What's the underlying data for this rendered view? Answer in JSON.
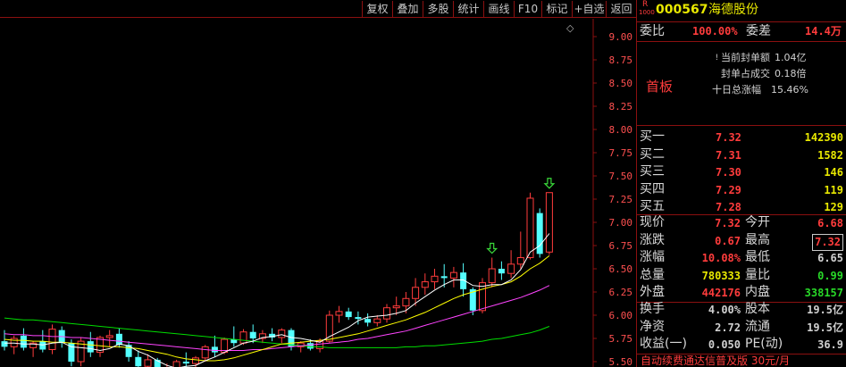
{
  "toolbar": {
    "buttons": [
      "复权",
      "叠加",
      "多股",
      "统计",
      "画线",
      "F10",
      "标记",
      "+自选",
      "返回"
    ]
  },
  "chart": {
    "y_ticks": [
      "9.00",
      "8.75",
      "8.50",
      "8.25",
      "8.00",
      "7.75",
      "7.50",
      "7.25",
      "7.00",
      "6.75",
      "6.50",
      "6.25",
      "6.00",
      "5.75",
      "5.50"
    ],
    "diamond_icon": "◇",
    "colors": {
      "up": "#ff3c3c",
      "down": "#54ffff",
      "ma5": "#ffffff",
      "ma10": "#ffff00",
      "ma20": "#ff44ff",
      "ma60": "#00dd00",
      "axis": "#8b1010",
      "tick_text": "#ff5050"
    }
  },
  "chart_data": {
    "type": "candlestick",
    "ylim": [
      5.5,
      9.0
    ],
    "candles": [
      {
        "o": 5.72,
        "h": 5.84,
        "l": 5.62,
        "c": 5.66
      },
      {
        "o": 5.66,
        "h": 5.78,
        "l": 5.58,
        "c": 5.75
      },
      {
        "o": 5.78,
        "h": 5.86,
        "l": 5.62,
        "c": 5.65
      },
      {
        "o": 5.65,
        "h": 5.72,
        "l": 5.55,
        "c": 5.7
      },
      {
        "o": 5.72,
        "h": 5.84,
        "l": 5.6,
        "c": 5.63
      },
      {
        "o": 5.63,
        "h": 5.9,
        "l": 5.58,
        "c": 5.85
      },
      {
        "o": 5.84,
        "h": 5.88,
        "l": 5.65,
        "c": 5.7
      },
      {
        "o": 5.7,
        "h": 5.74,
        "l": 5.45,
        "c": 5.5
      },
      {
        "o": 5.5,
        "h": 5.76,
        "l": 5.45,
        "c": 5.72
      },
      {
        "o": 5.72,
        "h": 5.82,
        "l": 5.55,
        "c": 5.6
      },
      {
        "o": 5.6,
        "h": 5.78,
        "l": 5.55,
        "c": 5.76
      },
      {
        "o": 5.76,
        "h": 5.84,
        "l": 5.66,
        "c": 5.78
      },
      {
        "o": 5.8,
        "h": 5.86,
        "l": 5.65,
        "c": 5.68
      },
      {
        "o": 5.68,
        "h": 5.72,
        "l": 5.5,
        "c": 5.55
      },
      {
        "o": 5.55,
        "h": 5.62,
        "l": 5.4,
        "c": 5.45
      },
      {
        "o": 5.45,
        "h": 5.58,
        "l": 5.35,
        "c": 5.52
      },
      {
        "o": 5.52,
        "h": 5.54,
        "l": 5.3,
        "c": 5.35
      },
      {
        "o": 5.35,
        "h": 5.48,
        "l": 5.28,
        "c": 5.4
      },
      {
        "o": 5.4,
        "h": 5.52,
        "l": 5.3,
        "c": 5.5
      },
      {
        "o": 5.5,
        "h": 5.6,
        "l": 5.42,
        "c": 5.48
      },
      {
        "o": 5.48,
        "h": 5.56,
        "l": 5.42,
        "c": 5.54
      },
      {
        "o": 5.54,
        "h": 5.68,
        "l": 5.5,
        "c": 5.66
      },
      {
        "o": 5.66,
        "h": 5.78,
        "l": 5.55,
        "c": 5.6
      },
      {
        "o": 5.6,
        "h": 5.76,
        "l": 5.58,
        "c": 5.74
      },
      {
        "o": 5.74,
        "h": 5.88,
        "l": 5.66,
        "c": 5.7
      },
      {
        "o": 5.7,
        "h": 5.85,
        "l": 5.68,
        "c": 5.82
      },
      {
        "o": 5.82,
        "h": 5.9,
        "l": 5.7,
        "c": 5.75
      },
      {
        "o": 5.75,
        "h": 5.84,
        "l": 5.7,
        "c": 5.8
      },
      {
        "o": 5.8,
        "h": 5.86,
        "l": 5.72,
        "c": 5.76
      },
      {
        "o": 5.76,
        "h": 5.86,
        "l": 5.7,
        "c": 5.84
      },
      {
        "o": 5.84,
        "h": 5.86,
        "l": 5.62,
        "c": 5.66
      },
      {
        "o": 5.66,
        "h": 5.72,
        "l": 5.6,
        "c": 5.7
      },
      {
        "o": 5.7,
        "h": 5.74,
        "l": 5.62,
        "c": 5.64
      },
      {
        "o": 5.64,
        "h": 5.75,
        "l": 5.6,
        "c": 5.72
      },
      {
        "o": 5.72,
        "h": 6.05,
        "l": 5.7,
        "c": 6.0
      },
      {
        "o": 6.0,
        "h": 6.1,
        "l": 5.92,
        "c": 6.04
      },
      {
        "o": 6.04,
        "h": 6.08,
        "l": 5.95,
        "c": 5.98
      },
      {
        "o": 5.98,
        "h": 6.04,
        "l": 5.9,
        "c": 5.96
      },
      {
        "o": 5.96,
        "h": 6.02,
        "l": 5.88,
        "c": 5.92
      },
      {
        "o": 5.92,
        "h": 6.0,
        "l": 5.88,
        "c": 5.96
      },
      {
        "o": 5.96,
        "h": 6.12,
        "l": 5.92,
        "c": 6.08
      },
      {
        "o": 6.08,
        "h": 6.2,
        "l": 6.0,
        "c": 6.1
      },
      {
        "o": 6.1,
        "h": 6.25,
        "l": 6.02,
        "c": 6.18
      },
      {
        "o": 6.18,
        "h": 6.4,
        "l": 6.1,
        "c": 6.3
      },
      {
        "o": 6.3,
        "h": 6.45,
        "l": 6.22,
        "c": 6.36
      },
      {
        "o": 6.36,
        "h": 6.5,
        "l": 6.28,
        "c": 6.42
      },
      {
        "o": 6.42,
        "h": 6.55,
        "l": 6.3,
        "c": 6.4
      },
      {
        "o": 6.4,
        "h": 6.52,
        "l": 6.3,
        "c": 6.46
      },
      {
        "o": 6.46,
        "h": 6.56,
        "l": 6.2,
        "c": 6.28
      },
      {
        "o": 6.28,
        "h": 6.3,
        "l": 6.0,
        "c": 6.05
      },
      {
        "o": 6.05,
        "h": 6.4,
        "l": 6.02,
        "c": 6.35
      },
      {
        "o": 6.35,
        "h": 6.62,
        "l": 6.3,
        "c": 6.5
      },
      {
        "o": 6.5,
        "h": 6.58,
        "l": 6.38,
        "c": 6.45
      },
      {
        "o": 6.45,
        "h": 6.7,
        "l": 6.4,
        "c": 6.55
      },
      {
        "o": 6.55,
        "h": 6.9,
        "l": 6.5,
        "c": 6.62
      },
      {
        "o": 6.62,
        "h": 7.32,
        "l": 6.6,
        "c": 7.26
      },
      {
        "o": 7.1,
        "h": 7.15,
        "l": 6.62,
        "c": 6.66
      },
      {
        "o": 6.68,
        "h": 7.32,
        "l": 6.65,
        "c": 7.32
      }
    ],
    "ma5": [
      5.7,
      5.7,
      5.69,
      5.69,
      5.68,
      5.7,
      5.71,
      5.66,
      5.65,
      5.64,
      5.62,
      5.64,
      5.69,
      5.67,
      5.61,
      5.57,
      5.51,
      5.46,
      5.43,
      5.45,
      5.46,
      5.51,
      5.55,
      5.6,
      5.65,
      5.7,
      5.72,
      5.76,
      5.77,
      5.79,
      5.76,
      5.75,
      5.73,
      5.71,
      5.77,
      5.82,
      5.87,
      5.94,
      5.98,
      5.99,
      6.0,
      6.02,
      6.05,
      6.13,
      6.2,
      6.27,
      6.33,
      6.38,
      6.38,
      6.32,
      6.31,
      6.33,
      6.33,
      6.38,
      6.49,
      6.68,
      6.75,
      6.88
    ],
    "ma10": [
      5.74,
      5.73,
      5.73,
      5.72,
      5.72,
      5.71,
      5.71,
      5.7,
      5.69,
      5.68,
      5.67,
      5.66,
      5.66,
      5.65,
      5.64,
      5.62,
      5.6,
      5.58,
      5.55,
      5.53,
      5.52,
      5.51,
      5.51,
      5.52,
      5.54,
      5.57,
      5.6,
      5.63,
      5.66,
      5.69,
      5.7,
      5.71,
      5.72,
      5.73,
      5.74,
      5.76,
      5.78,
      5.8,
      5.83,
      5.86,
      5.89,
      5.92,
      5.95,
      5.99,
      6.03,
      6.08,
      6.13,
      6.18,
      6.22,
      6.25,
      6.28,
      6.31,
      6.33,
      6.36,
      6.42,
      6.5,
      6.56,
      6.64
    ],
    "ma20": [
      5.8,
      5.79,
      5.79,
      5.78,
      5.78,
      5.77,
      5.77,
      5.76,
      5.76,
      5.75,
      5.74,
      5.73,
      5.72,
      5.71,
      5.7,
      5.69,
      5.68,
      5.67,
      5.66,
      5.65,
      5.64,
      5.63,
      5.62,
      5.62,
      5.62,
      5.62,
      5.63,
      5.63,
      5.64,
      5.65,
      5.66,
      5.67,
      5.68,
      5.69,
      5.7,
      5.71,
      5.72,
      5.74,
      5.75,
      5.77,
      5.79,
      5.81,
      5.83,
      5.86,
      5.89,
      5.92,
      5.95,
      5.98,
      6.01,
      6.04,
      6.07,
      6.1,
      6.13,
      6.16,
      6.19,
      6.23,
      6.27,
      6.32
    ],
    "ma60": [
      5.97,
      5.96,
      5.95,
      5.95,
      5.94,
      5.93,
      5.92,
      5.91,
      5.9,
      5.89,
      5.88,
      5.87,
      5.86,
      5.85,
      5.84,
      5.83,
      5.82,
      5.81,
      5.8,
      5.79,
      5.78,
      5.77,
      5.76,
      5.75,
      5.74,
      5.73,
      5.72,
      5.71,
      5.7,
      5.69,
      5.68,
      5.67,
      5.66,
      5.66,
      5.65,
      5.65,
      5.65,
      5.65,
      5.65,
      5.65,
      5.65,
      5.65,
      5.66,
      5.66,
      5.67,
      5.67,
      5.68,
      5.69,
      5.7,
      5.71,
      5.72,
      5.74,
      5.75,
      5.77,
      5.79,
      5.81,
      5.84,
      5.88
    ],
    "arrows": [
      51,
      57
    ]
  },
  "panel": {
    "market_badge": "R",
    "market_badge_sub": "1000",
    "code": "000567",
    "name": "海德股份",
    "weibi_label": "委比",
    "weibi_value": "100.00%",
    "weicha_label": "委差",
    "weicha_value": "14.4万",
    "first_board": "首板",
    "seal_amount_label": "当前封单额",
    "seal_amount_value": "1.04亿",
    "seal_ratio_label": "封单占成交",
    "seal_ratio_value": "0.18倍",
    "ten_day_label": "十日总涨幅",
    "ten_day_value": "15.46%",
    "bids": [
      {
        "label": "买一",
        "price": "7.32",
        "vol": "142390"
      },
      {
        "label": "买二",
        "price": "7.31",
        "vol": "1582"
      },
      {
        "label": "买三",
        "price": "7.30",
        "vol": "146"
      },
      {
        "label": "买四",
        "price": "7.29",
        "vol": "119"
      },
      {
        "label": "买五",
        "price": "7.28",
        "vol": "129"
      }
    ],
    "quote": [
      {
        "l1": "现价",
        "v1": "7.32",
        "c1": "red",
        "l2": "今开",
        "v2": "6.68",
        "c2": "red"
      },
      {
        "l1": "涨跌",
        "v1": "0.67",
        "c1": "red",
        "l2": "最高",
        "v2": "7.32",
        "c2": "red"
      },
      {
        "l1": "涨幅",
        "v1": "10.08%",
        "c1": "red",
        "l2": "最低",
        "v2": "6.65",
        "c2": "white"
      },
      {
        "l1": "总量",
        "v1": "780333",
        "c1": "yellow",
        "l2": "量比",
        "v2": "0.99",
        "c2": "green"
      },
      {
        "l1": "外盘",
        "v1": "442176",
        "c1": "red",
        "l2": "内盘",
        "v2": "338157",
        "c2": "green"
      }
    ],
    "fund": [
      {
        "l1": "换手",
        "v1": "4.00%",
        "l2": "股本",
        "v2": "19.5亿"
      },
      {
        "l1": "净资",
        "v1": "2.72",
        "l2": "流通",
        "v2": "19.5亿"
      },
      {
        "l1": "收益(一)",
        "v1": "0.050",
        "l2": "PE(动)",
        "v2": "36.9"
      }
    ],
    "ad": "自动续费通达信普及版 30元/月"
  }
}
